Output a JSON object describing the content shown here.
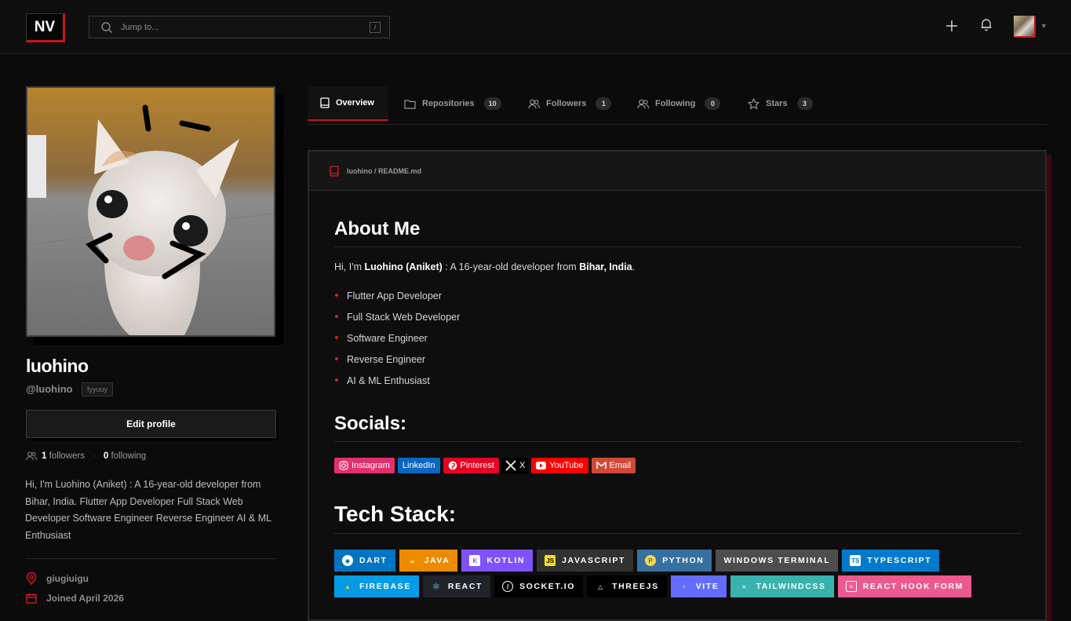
{
  "header": {
    "logo": "NV",
    "search_placeholder": "Jump to...",
    "search_shortcut": "/"
  },
  "profile": {
    "display_name": "luohino",
    "handle": "@luohino",
    "pronouns": "fyyuuy",
    "edit_button": "Edit profile",
    "followers_count": "1",
    "followers_label": "followers",
    "following_count": "0",
    "following_label": "following",
    "bio": "Hi, I'm Luohino (Aniket) : A 16-year-old developer from Bihar, India. Flutter App Developer Full Stack Web Developer Software Engineer Reverse Engineer AI & ML Enthusiast",
    "location": "giugiuigu",
    "joined": "Joined April 2026"
  },
  "tabs": [
    {
      "label": "Overview",
      "count": null
    },
    {
      "label": "Repositories",
      "count": "10"
    },
    {
      "label": "Followers",
      "count": "1"
    },
    {
      "label": "Following",
      "count": "0"
    },
    {
      "label": "Stars",
      "count": "3"
    }
  ],
  "readme": {
    "path": "luohino / README.md",
    "about_heading": "About Me",
    "intro_prefix": "Hi, I'm ",
    "intro_name": "Luohino (Aniket)",
    "intro_middle": " : A 16-year-old developer from ",
    "intro_place": "Bihar, India",
    "intro_suffix": ".",
    "skills": [
      "Flutter App Developer",
      "Full Stack Web Developer",
      "Software Engineer",
      "Reverse Engineer",
      "AI & ML Enthusiast"
    ],
    "socials_heading": "Socials:",
    "socials": [
      {
        "label": "Instagram",
        "color": "#e1306c"
      },
      {
        "label": "LinkedIn",
        "color": "#0a66c2"
      },
      {
        "label": "Pinterest",
        "color": "#e60023"
      },
      {
        "label": "X",
        "color": "#000000"
      },
      {
        "label": "YouTube",
        "color": "#ff0000"
      },
      {
        "label": "Email",
        "color": "#d14836"
      }
    ],
    "tech_heading": "Tech Stack:",
    "tech": [
      {
        "label": "DART",
        "color": "#0175c2"
      },
      {
        "label": "JAVA",
        "color": "#ed8b00"
      },
      {
        "label": "KOTLIN",
        "color": "#7f52ff"
      },
      {
        "label": "JAVASCRIPT",
        "color": "#323330"
      },
      {
        "label": "PYTHON",
        "color": "#3670a0"
      },
      {
        "label": "WINDOWS TERMINAL",
        "color": "#4d4d4d"
      },
      {
        "label": "TYPESCRIPT",
        "color": "#007acc"
      },
      {
        "label": "FIREBASE",
        "color": "#039be5"
      },
      {
        "label": "REACT",
        "color": "#20232a"
      },
      {
        "label": "SOCKET.IO",
        "color": "#010101"
      },
      {
        "label": "THREEJS",
        "color": "#000000"
      },
      {
        "label": "VITE",
        "color": "#646cff"
      },
      {
        "label": "TAILWINDCSS",
        "color": "#38b2ac"
      },
      {
        "label": "REACT HOOK FORM",
        "color": "#ec5990"
      }
    ]
  }
}
